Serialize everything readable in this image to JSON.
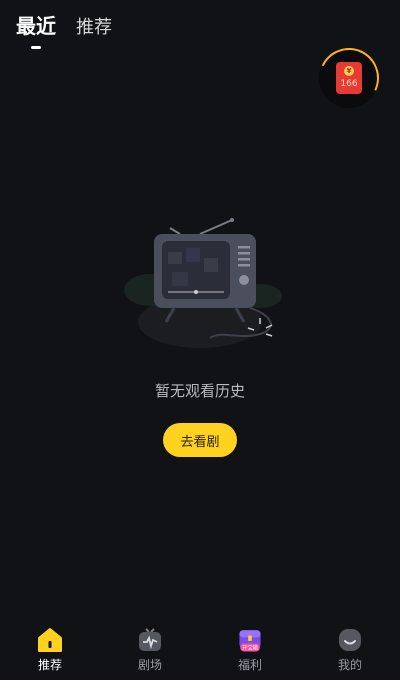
{
  "tabs": [
    {
      "label": "最近",
      "active": true
    },
    {
      "label": "推荐",
      "active": false
    }
  ],
  "reward": {
    "count": "166",
    "coin_symbol": "¥"
  },
  "empty_state": {
    "message": "暂无观看历史",
    "button_label": "去看剧"
  },
  "bottom_nav": [
    {
      "label": "推荐",
      "icon": "home-icon",
      "active": true
    },
    {
      "label": "剧场",
      "icon": "tv-icon",
      "active": false
    },
    {
      "label": "福利",
      "icon": "treasure-box-icon",
      "badge": "开宝箱",
      "active": false
    },
    {
      "label": "我的",
      "icon": "profile-icon",
      "active": false
    }
  ],
  "colors": {
    "accent": "#ffd21f",
    "background": "#111215",
    "red": "#e83a34"
  }
}
